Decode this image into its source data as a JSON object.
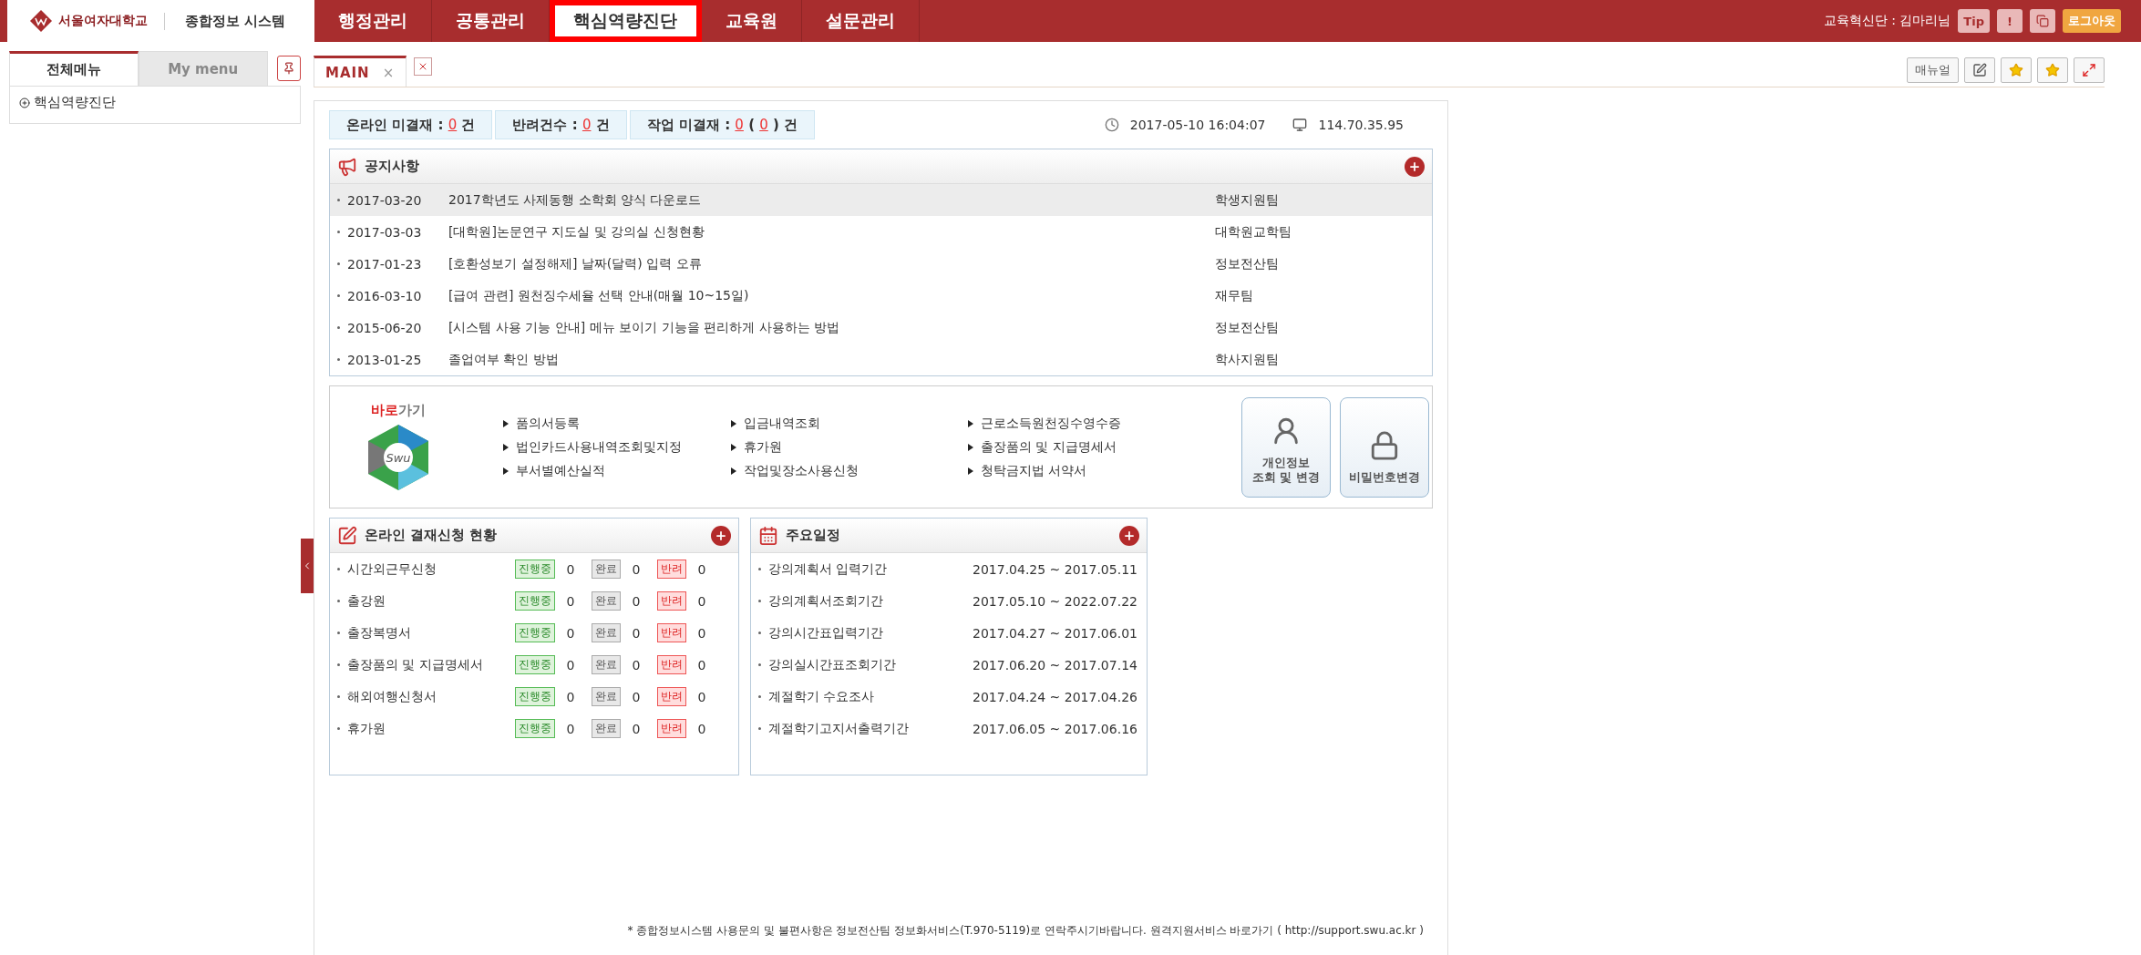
{
  "header": {
    "logo_text": "서울여자대학교",
    "system_title": "종합정보 시스템",
    "menus": [
      {
        "label": "행정관리",
        "selected": false
      },
      {
        "label": "공통관리",
        "selected": false
      },
      {
        "label": "핵심역량진단",
        "selected": true
      },
      {
        "label": "교육원",
        "selected": false
      },
      {
        "label": "설문관리",
        "selected": false
      }
    ],
    "user": "교육혁신단 : 김마리님",
    "tip": "Tip",
    "alert": "!",
    "logout": "로그아웃"
  },
  "sidebar": {
    "tabs": [
      {
        "label": "전체메뉴",
        "selected": true
      },
      {
        "label": "My menu",
        "selected": false
      }
    ],
    "tree": [
      {
        "label": "핵심역량진단",
        "expanded": false
      }
    ]
  },
  "page_tabs": [
    {
      "label": "MAIN",
      "selected": true,
      "close": "×"
    }
  ],
  "toolbar": {
    "manual": "매뉴얼"
  },
  "status": [
    {
      "parts": [
        {
          "kind": "text",
          "text": "온라인 미결재 : "
        },
        {
          "kind": "count",
          "text": "0"
        },
        {
          "kind": "text",
          "text": " 건"
        }
      ]
    },
    {
      "parts": [
        {
          "kind": "text",
          "text": "반려건수 : "
        },
        {
          "kind": "count",
          "text": "0"
        },
        {
          "kind": "text",
          "text": " 건"
        }
      ]
    },
    {
      "parts": [
        {
          "kind": "text",
          "text": "작업 미결재 : "
        },
        {
          "kind": "count",
          "text": "0"
        },
        {
          "kind": "text",
          "text": " ( "
        },
        {
          "kind": "count",
          "text": "0"
        },
        {
          "kind": "text",
          "text": " ) 건"
        }
      ]
    }
  ],
  "datetime": "2017-05-10 16:04:07",
  "ip": "114.70.35.95",
  "notices": {
    "title": "공지사항",
    "rows": [
      {
        "date": "2017-03-20",
        "title": "2017학년도 사제동행 소학회 양식 다운로드",
        "team": "학생지원팀",
        "selected": true
      },
      {
        "date": "2017-03-03",
        "title": "[대학원]논문연구 지도실 및 강의실 신청현황",
        "team": "대학원교학팀",
        "selected": false
      },
      {
        "date": "2017-01-23",
        "title": "[호환성보기 설정해제] 날짜(달력) 입력 오류",
        "team": "정보전산팀",
        "selected": false
      },
      {
        "date": "2016-03-10",
        "title": "[급여 관련] 원천징수세율 선택 안내(매월 10~15일)",
        "team": "재무팀",
        "selected": false
      },
      {
        "date": "2015-06-20",
        "title": "[시스템 사용 기능 안내] 메뉴 보이기 기능을 편리하게 사용하는 방법",
        "team": "정보전산팀",
        "selected": false
      },
      {
        "date": "2013-01-25",
        "title": "졸업여부 확인 방법",
        "team": "학사지원팀",
        "selected": false
      }
    ]
  },
  "quick_links": {
    "title_parts": [
      {
        "text": "바로",
        "accent": true
      },
      {
        "text": "가기",
        "accent": false
      }
    ],
    "logo_text": "Swu",
    "links": [
      "품의서등록",
      "입금내역조회",
      "근로소득원천징수영수증",
      "법인카드사용내역조회및지정",
      "휴가원",
      "출장품의 및 지급명세서",
      "부서별예산실적",
      "작업및장소사용신청",
      "청탁금지법 서약서"
    ],
    "buttons": [
      {
        "kind": "profile",
        "label": "개인정보\n조회 및 변경"
      },
      {
        "kind": "password",
        "label": "비밀번호변경"
      }
    ]
  },
  "approvals": {
    "title": "온라인 결재신청 현황",
    "rows": [
      {
        "name": "시간외근무신청",
        "counts": [
          {
            "kind": "progress",
            "label": "진행중",
            "value": "0"
          },
          {
            "kind": "done",
            "label": "완료",
            "value": "0"
          },
          {
            "kind": "rejected",
            "label": "반려",
            "value": "0"
          }
        ]
      },
      {
        "name": "출강원",
        "counts": [
          {
            "kind": "progress",
            "label": "진행중",
            "value": "0"
          },
          {
            "kind": "done",
            "label": "완료",
            "value": "0"
          },
          {
            "kind": "rejected",
            "label": "반려",
            "value": "0"
          }
        ]
      },
      {
        "name": "출장복명서",
        "counts": [
          {
            "kind": "progress",
            "label": "진행중",
            "value": "0"
          },
          {
            "kind": "done",
            "label": "완료",
            "value": "0"
          },
          {
            "kind": "rejected",
            "label": "반려",
            "value": "0"
          }
        ]
      },
      {
        "name": "출장품의 및 지급명세서",
        "counts": [
          {
            "kind": "progress",
            "label": "진행중",
            "value": "0"
          },
          {
            "kind": "done",
            "label": "완료",
            "value": "0"
          },
          {
            "kind": "rejected",
            "label": "반려",
            "value": "0"
          }
        ]
      },
      {
        "name": "해외여행신청서",
        "counts": [
          {
            "kind": "progress",
            "label": "진행중",
            "value": "0"
          },
          {
            "kind": "done",
            "label": "완료",
            "value": "0"
          },
          {
            "kind": "rejected",
            "label": "반려",
            "value": "0"
          }
        ]
      },
      {
        "name": "휴가원",
        "counts": [
          {
            "kind": "progress",
            "label": "진행중",
            "value": "0"
          },
          {
            "kind": "done",
            "label": "완료",
            "value": "0"
          },
          {
            "kind": "rejected",
            "label": "반려",
            "value": "0"
          }
        ]
      }
    ]
  },
  "schedule": {
    "title": "주요일정",
    "rows": [
      {
        "name": "강의계획서 입력기간",
        "period": "2017.04.25 ~ 2017.05.11"
      },
      {
        "name": "강의계획서조회기간",
        "period": "2017.05.10 ~ 2022.07.22"
      },
      {
        "name": "강의시간표입력기간",
        "period": "2017.04.27 ~ 2017.06.01"
      },
      {
        "name": "강의실시간표조회기간",
        "period": "2017.06.20 ~ 2017.07.14"
      },
      {
        "name": "계절학기 수요조사",
        "period": "2017.04.24 ~ 2017.04.26"
      },
      {
        "name": "계절학기고지서출력기간",
        "period": "2017.06.05 ~ 2017.06.16"
      }
    ]
  },
  "footer": {
    "text": "* 종합정보시스템 사용문의 및 불편사항은 정보전산팀 정보화서비스(T.970-5119)로 연락주시기바랍니다. 원격지원서비스 바로가기 ( ",
    "link": "http://support.swu.ac.kr",
    "end": " )"
  }
}
